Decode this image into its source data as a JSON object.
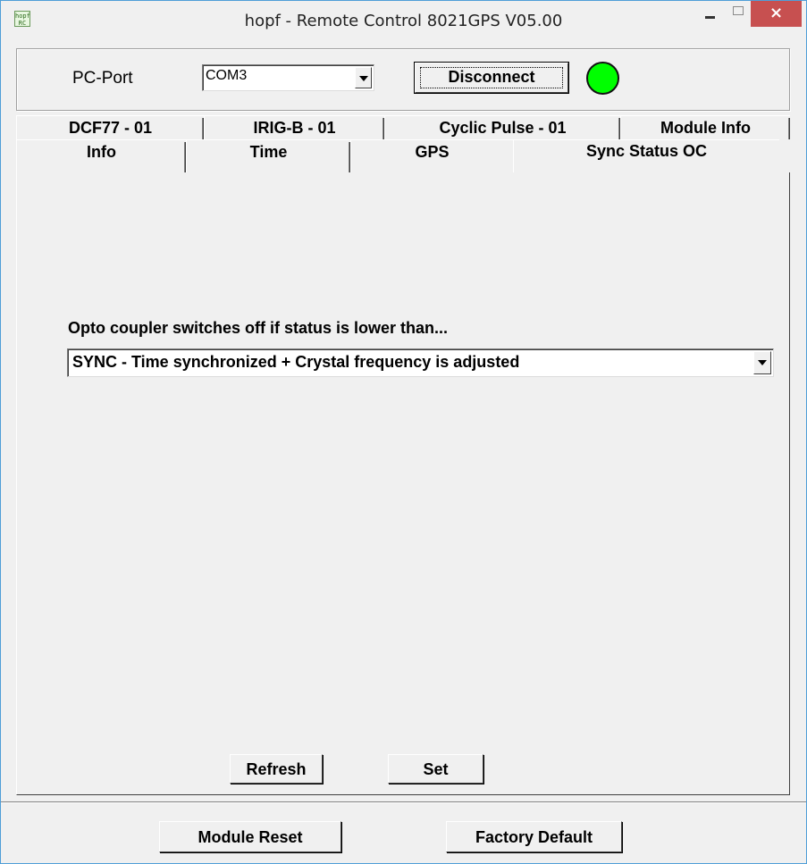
{
  "window": {
    "title": "hopf - Remote Control  8021GPS V05.00",
    "icon_text": "hopf RC",
    "controls": {
      "minimize": "–",
      "maximize": "□",
      "close": "×"
    }
  },
  "port_panel": {
    "label": "PC-Port",
    "port_value": "COM3",
    "disconnect_label": "Disconnect",
    "status_color": "#00ff00"
  },
  "tabs": {
    "row1": [
      "DCF77 - 01",
      "IRIG-B - 01",
      "Cyclic Pulse - 01",
      "Module Info"
    ],
    "row2": [
      "Info",
      "Time",
      "GPS",
      "Sync Status OC"
    ],
    "selected": "Sync Status OC"
  },
  "sync_status": {
    "prompt": "Opto coupler switches off if status is lower than...",
    "selected_option": "SYNC -  Time synchronized +  Crystal frequency is adjusted"
  },
  "actions": {
    "refresh_label": "Refresh",
    "set_label": "Set"
  },
  "footer": {
    "module_reset_label": "Module Reset",
    "factory_default_label": "Factory Default"
  }
}
